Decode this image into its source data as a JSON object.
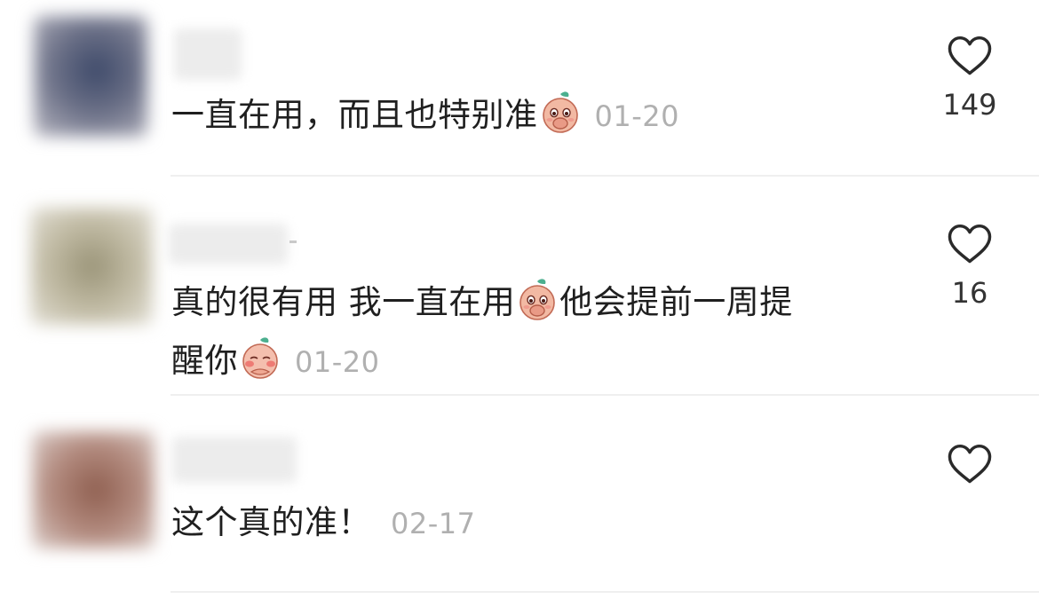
{
  "comments": [
    {
      "text_parts": [
        "一直在用，而且也特别准"
      ],
      "emoji": "peach-shy-emoji",
      "date": "01-20",
      "likes": "149",
      "avatar_color": "#3e4a6a"
    },
    {
      "text_line1_a": "真的很有用 我一直在用",
      "text_line1_b": "他会提前一周提",
      "text_line2": "醒你",
      "emoji_1": "peach-shy-emoji",
      "emoji_2": "peach-blush-emoji",
      "date": "01-20",
      "likes": "16",
      "avatar_color": "#9a9478"
    },
    {
      "text": "这个真的准！",
      "date": "02-17",
      "likes": "",
      "avatar_color": "#8f5f50"
    }
  ],
  "icons": {
    "like": "heart-outline-icon"
  }
}
